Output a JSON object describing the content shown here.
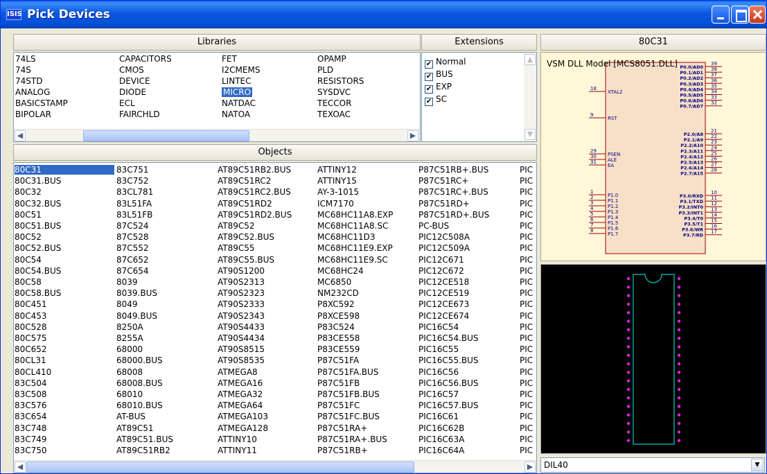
{
  "window": {
    "title": "Pick Devices",
    "icon_text": "ISIS"
  },
  "headers": {
    "libraries": "Libraries",
    "extensions": "Extensions",
    "device": "80C31",
    "objects": "Objects"
  },
  "libraries": {
    "columns": [
      [
        "74LS",
        "74S",
        "74STD",
        "ANALOG",
        "BASICSTAMP",
        "BIPOLAR"
      ],
      [
        "CAPACITORS",
        "CMOS",
        "DEVICE",
        "DIODE",
        "ECL",
        "FAIRCHLD"
      ],
      [
        "FET",
        "I2CMEMS",
        "LINTEC",
        "MICRO",
        "NATDAC",
        "NATOA"
      ],
      [
        "OPAMP",
        "PLD",
        "RESISTORS",
        "SYSDVC",
        "TECCOR",
        "TEXOAC"
      ]
    ],
    "selected": "MICRO"
  },
  "extensions": [
    {
      "label": "Normal",
      "checked": true
    },
    {
      "label": "BUS",
      "checked": true
    },
    {
      "label": "EXP",
      "checked": true
    },
    {
      "label": "SC",
      "checked": true
    }
  ],
  "objects": {
    "columns": [
      [
        "80C31",
        "80C31.BUS",
        "80C32",
        "80C32.BUS",
        "80C51",
        "80C51.BUS",
        "80C52",
        "80C52.BUS",
        "80C54",
        "80C54.BUS",
        "80C58",
        "80C58.BUS",
        "80C451",
        "80C453",
        "80C528",
        "80C575",
        "80C652",
        "80CL31",
        "80CL410",
        "83C504",
        "83C508",
        "83C576",
        "83C654",
        "83C748",
        "83C749",
        "83C750"
      ],
      [
        "83C751",
        "83C752",
        "83CL781",
        "83L51FA",
        "83L51FB",
        "87C524",
        "87C528",
        "87C552",
        "87C652",
        "87C654",
        "8039",
        "8039.BUS",
        "8049",
        "8049.BUS",
        "8250A",
        "8255A",
        "68000",
        "68000.BUS",
        "68008",
        "68008.BUS",
        "68010",
        "68010.BUS",
        "AT-BUS",
        "AT89C51",
        "AT89C51.BUS",
        "AT89C51RB2"
      ],
      [
        "AT89C51RB2.BUS",
        "AT89C51RC2",
        "AT89C51RC2.BUS",
        "AT89C51RD2",
        "AT89C51RD2.BUS",
        "AT89C52",
        "AT89C52.BUS",
        "AT89C55",
        "AT89C55.BUS",
        "AT90S1200",
        "AT90S2313",
        "AT90S2323",
        "AT90S2333",
        "AT90S2343",
        "AT90S4433",
        "AT90S4434",
        "AT90S8515",
        "AT90S8535",
        "ATMEGA8",
        "ATMEGA16",
        "ATMEGA32",
        "ATMEGA64",
        "ATMEGA103",
        "ATMEGA128",
        "ATTINY10",
        "ATTINY11"
      ],
      [
        "ATTINY12",
        "ATTINY15",
        "AY-3-1015",
        "ICM7170",
        "MC68HC11A8.EXP",
        "MC68HC11A8.SC",
        "MC68HC11D3",
        "MC68HC11E9.EXP",
        "MC68HC11E9.SC",
        "MC68HC24",
        "MC6850",
        "NM232CD",
        "P8XC592",
        "P8XCE598",
        "P83C524",
        "P83CE558",
        "P83CE559",
        "P87C51FA",
        "P87C51FA.BUS",
        "P87C51FB",
        "P87C51FB.BUS",
        "P87C51FC",
        "P87C51FC.BUS",
        "P87C51RA+",
        "P87C51RA+.BUS",
        "P87C51RB+"
      ],
      [
        "P87C51RB+.BUS",
        "P87C51RC+",
        "P87C51RC+.BUS",
        "P87C51RD+",
        "P87C51RD+.BUS",
        "PC-BUS",
        "PIC12C508A",
        "PIC12C509A",
        "PIC12C671",
        "PIC12C672",
        "PIC12CE518",
        "PIC12CE519",
        "PIC12CE673",
        "PIC12CE674",
        "PIC16C54",
        "PIC16C54.BUS",
        "PIC16C55",
        "PIC16C55.BUS",
        "PIC16C56",
        "PIC16C56.BUS",
        "PIC16C57",
        "PIC16C57.BUS",
        "PIC16C61",
        "PIC16C62B",
        "PIC16C63A",
        "PIC16C64A"
      ],
      [
        "PIC",
        "PIC",
        "PIC",
        "PIC",
        "PIC",
        "PIC",
        "PIC",
        "PIC",
        "PIC",
        "PIC",
        "PIC",
        "PIC",
        "PIC",
        "PIC",
        "PIC",
        "PIC",
        "PIC",
        "PIC",
        "PIC",
        "PIC",
        "PIC",
        "PIC",
        "PIC",
        "PIC",
        "PIC",
        "PIC"
      ]
    ],
    "selected": "80C31"
  },
  "schematic": {
    "model_label": "VSM DLL Model [MCS8051.DLL]",
    "left_pins": [
      {
        "num": "18",
        "name": "XTAL2"
      },
      {
        "num": "9",
        "name": "RST"
      },
      {
        "num": "29",
        "name": "PSEN"
      },
      {
        "num": "30",
        "name": "ALE"
      },
      {
        "num": "31",
        "name": "EA"
      },
      {
        "num": "1",
        "name": "P1.0"
      },
      {
        "num": "2",
        "name": "P1.1"
      },
      {
        "num": "3",
        "name": "P1.2"
      },
      {
        "num": "4",
        "name": "P1.3"
      },
      {
        "num": "5",
        "name": "P1.4"
      },
      {
        "num": "6",
        "name": "P1.5"
      },
      {
        "num": "7",
        "name": "P1.6"
      },
      {
        "num": "8",
        "name": "P1.7"
      }
    ],
    "right_pins": [
      {
        "num": "39",
        "name": "P0.0/AD0"
      },
      {
        "num": "38",
        "name": "P0.1/AD1"
      },
      {
        "num": "37",
        "name": "P0.2/AD2"
      },
      {
        "num": "36",
        "name": "P0.3/AD3"
      },
      {
        "num": "35",
        "name": "P0.4/AD4"
      },
      {
        "num": "34",
        "name": "P0.5/AD5"
      },
      {
        "num": "33",
        "name": "P0.6/AD6"
      },
      {
        "num": "32",
        "name": "P0.7/AD7"
      },
      {
        "num": "21",
        "name": "P2.0/A8"
      },
      {
        "num": "22",
        "name": "P2.1/A9"
      },
      {
        "num": "23",
        "name": "P2.2/A10"
      },
      {
        "num": "24",
        "name": "P2.3/A11"
      },
      {
        "num": "25",
        "name": "P2.4/A12"
      },
      {
        "num": "26",
        "name": "P2.5/A13"
      },
      {
        "num": "27",
        "name": "P2.6/A14"
      },
      {
        "num": "28",
        "name": "P2.7/A15"
      },
      {
        "num": "10",
        "name": "P3.0/RXD"
      },
      {
        "num": "11",
        "name": "P3.1/TXD"
      },
      {
        "num": "12",
        "name": "P3.2/INT0"
      },
      {
        "num": "13",
        "name": "P3.3/INT1"
      },
      {
        "num": "14",
        "name": "P3.4/T0"
      },
      {
        "num": "15",
        "name": "P3.5/T1"
      },
      {
        "num": "16",
        "name": "P3.6/WR"
      },
      {
        "num": "17",
        "name": "P3.7/RD"
      }
    ]
  },
  "package": {
    "value": "DIL40"
  },
  "colors": {
    "title_bar": "#0a57e0",
    "selection": "#316ac5",
    "schematic_bg": "#fff7d8",
    "pcb_bg": "#000000",
    "pcb_outline": "#00c8c8",
    "pcb_pad": "#e020e0",
    "schematic_line": "#a00000",
    "schematic_text": "#000080"
  }
}
